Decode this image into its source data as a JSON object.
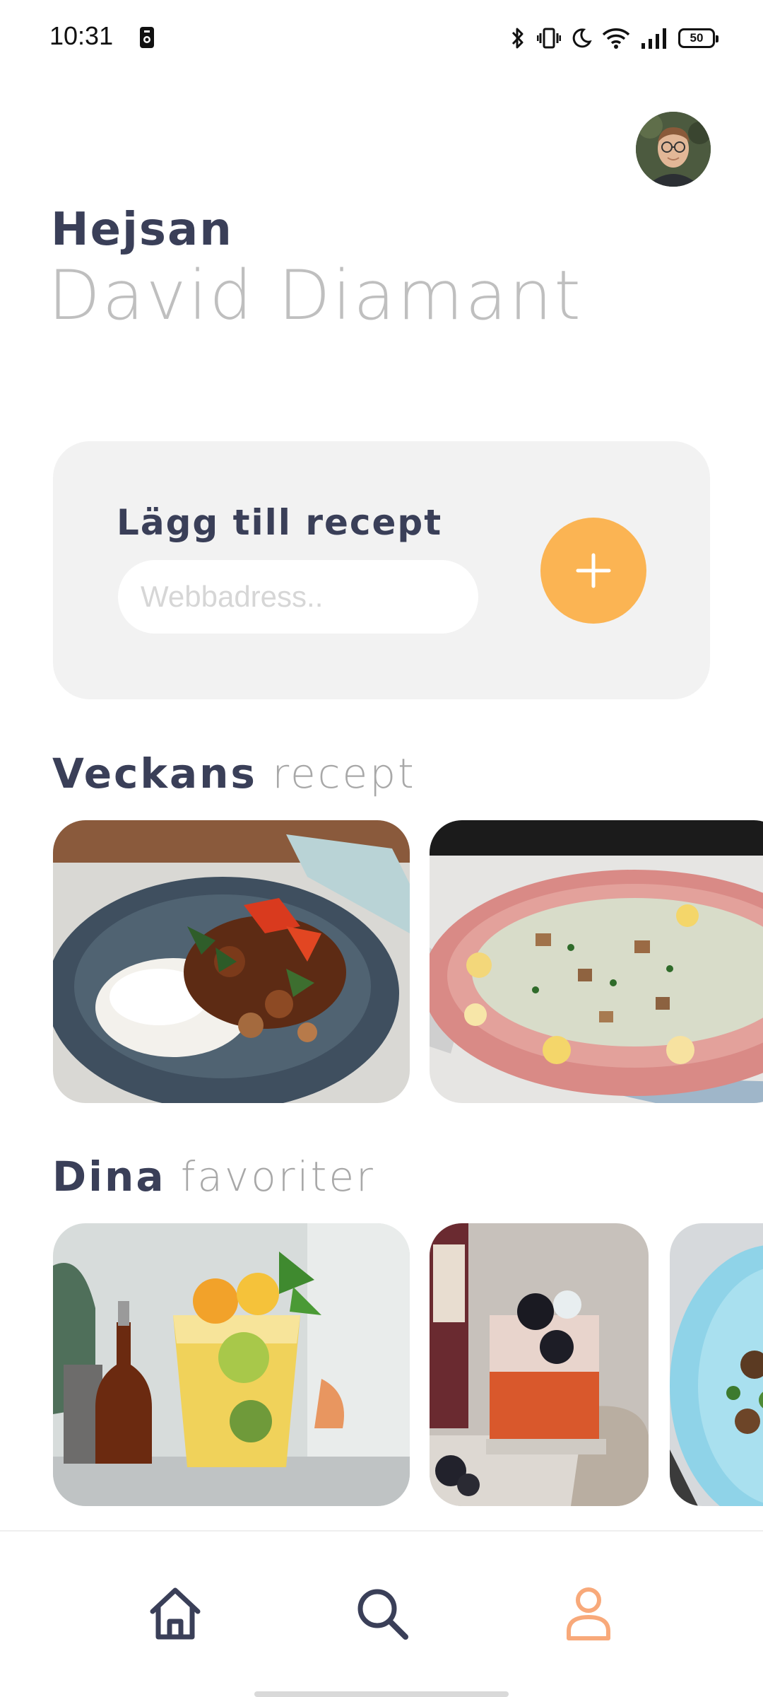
{
  "status_bar": {
    "time": "10:31",
    "battery": "50",
    "icons": [
      "bluetooth-icon",
      "vibrate-icon",
      "do-not-disturb-icon",
      "wifi-icon",
      "signal-icon",
      "battery-icon"
    ]
  },
  "header": {
    "greeting": "Hejsan",
    "user_name": "David Diamant"
  },
  "add_recipe": {
    "title": "Lägg till recept",
    "input_value": "",
    "input_placeholder": "Webbadress..",
    "button_icon": "plus-icon"
  },
  "weekly": {
    "title_strong": "Veckans",
    "title_light": "recept",
    "items": [
      "mushroom-rice-dish",
      "egg-salad-bowl"
    ]
  },
  "favorites": {
    "title_strong": "Dina",
    "title_light": "favoriter",
    "items": [
      "citrus-cocktail",
      "blackberry-drink",
      "salad-plate"
    ]
  },
  "nav": {
    "items": [
      "home-icon",
      "search-icon",
      "profile-icon"
    ],
    "active": "profile-icon"
  },
  "colors": {
    "accent": "#fbb453",
    "text_dark": "#3a3f58",
    "text_light": "#bfbfbf",
    "card_bg": "#f2f2f2",
    "nav_active": "#f8a97a"
  }
}
